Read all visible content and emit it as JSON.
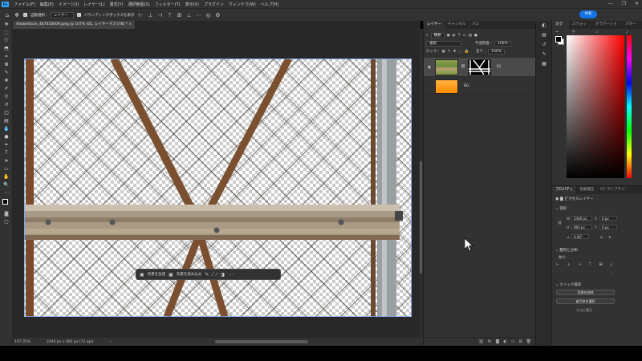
{
  "app": {
    "logo": "Ps",
    "menu": [
      "ファイル(F)",
      "編集(E)",
      "イメージ(I)",
      "レイヤー(L)",
      "書式(Y)",
      "選択範囲(S)",
      "フィルター(T)",
      "表示(V)",
      "プラグイン",
      "ウィンドウ(W)",
      "ヘルプ(H)"
    ]
  },
  "options": {
    "auto_select": "自動選択 :",
    "target": "レイヤー",
    "bbox": "バウンディングボックスを表示",
    "share": "共有"
  },
  "document": {
    "tab": "AdobeStock_447016609.jpeg @ 107% (01, レイヤーマスク/8) *",
    "zoom": "107.35%",
    "size": "2440 px x 960 px (72 ppi)"
  },
  "contextbar": {
    "generate_bg": "背景を生成",
    "import_bg": "背景を読み込み"
  },
  "layers_panel": {
    "tabs": [
      "レイヤー",
      "チャンネル",
      "パス"
    ],
    "filter": "種類",
    "blend": "通常",
    "opacity_label": "不透明度 :",
    "opacity": "100%",
    "lock_label": "ロック :",
    "fill_label": "塗り :",
    "fill": "100%",
    "layers": [
      {
        "name": "01"
      },
      {
        "name": "BG"
      }
    ]
  },
  "color_panel": {
    "tabs": [
      "カラー",
      "スウォッチ",
      "グラデーション",
      "パターン"
    ],
    "fg": "#000000",
    "bg": "#ffffff",
    "hue": "#ff0000"
  },
  "properties": {
    "tabs": [
      "プロパティ",
      "色調補正",
      "CC ライブラリ"
    ],
    "kind": "ピクセルレイヤー",
    "transform": "変形",
    "w": "2440 px",
    "x": "0 px",
    "h": "960 px",
    "y": "0 px",
    "angle": "0.00°",
    "align": "整列と分布",
    "align_sub": "整列 :",
    "quick": "クイック操作",
    "remove_bg": "背景を削除",
    "select_subject": "被写体を選択",
    "more": "さらに表示"
  }
}
